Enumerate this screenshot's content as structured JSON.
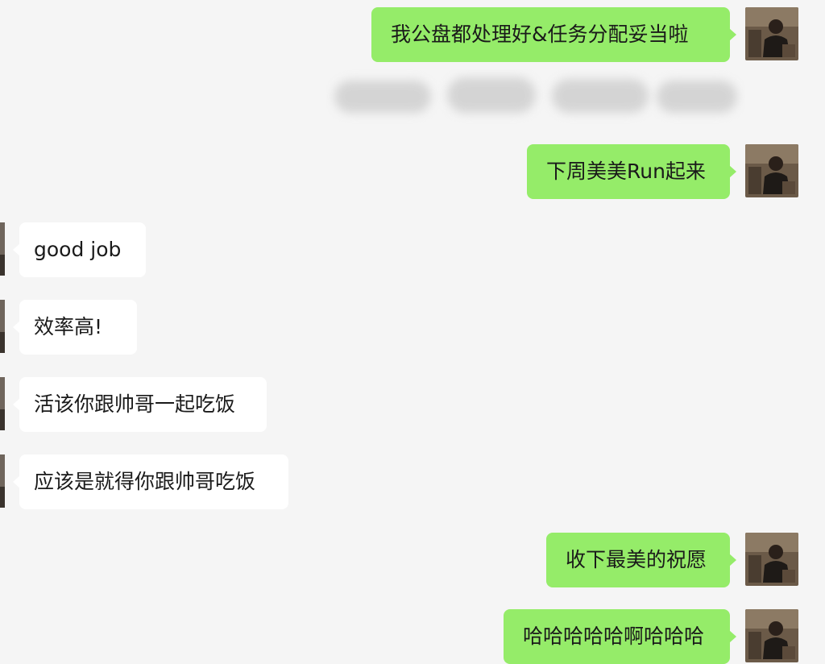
{
  "chat": {
    "messages": [
      {
        "id": "m1",
        "side": "out",
        "text": "我公盘都处理好&任务分配妥当啦"
      },
      {
        "id": "m2",
        "side": "redacted",
        "text": ""
      },
      {
        "id": "m3",
        "side": "out",
        "text": "下周美美Run起来"
      },
      {
        "id": "m4",
        "side": "in",
        "text": "good job"
      },
      {
        "id": "m5",
        "side": "in",
        "text": "效率高!"
      },
      {
        "id": "m6",
        "side": "in",
        "text": "活该你跟帅哥一起吃饭"
      },
      {
        "id": "m7",
        "side": "in",
        "text": "应该是就得你跟帅哥吃饭"
      },
      {
        "id": "m8",
        "side": "out",
        "text": "收下最美的祝愿"
      },
      {
        "id": "m9",
        "side": "out",
        "text": "哈哈哈哈哈啊哈哈哈"
      }
    ]
  },
  "colors": {
    "background": "#f5f5f5",
    "outgoing_bubble": "#95ec69",
    "incoming_bubble": "#ffffff",
    "text": "#1a1a1a"
  }
}
